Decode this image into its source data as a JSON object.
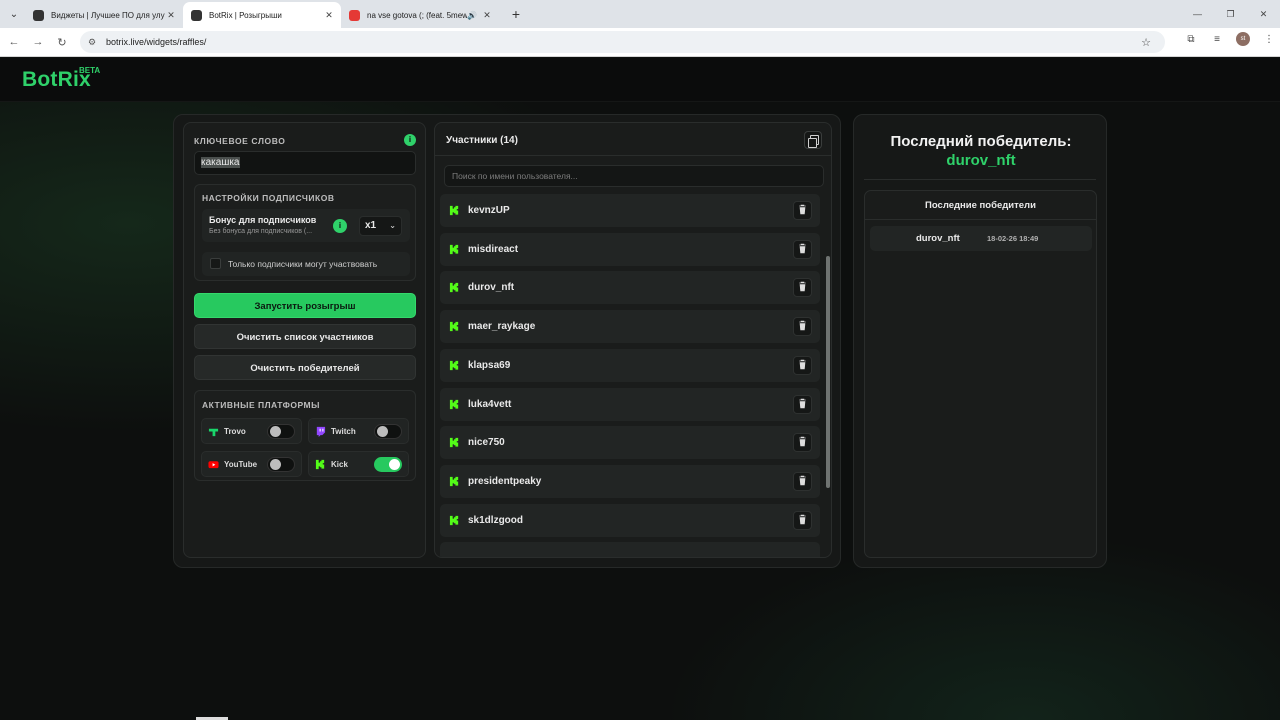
{
  "browser": {
    "tabs": [
      {
        "title": "Виджеты | Лучшее ПО для улу",
        "favicon_color": "#333333"
      },
      {
        "title": "BotRix | Розыгрыши",
        "favicon_color": "#333333"
      },
      {
        "title": "na vse gotova (; (feat. 5mewm",
        "favicon_color": "#e53935"
      }
    ],
    "url": "botrix.live/widgets/raffles/",
    "profile_initials": "st"
  },
  "brand": {
    "name": "BotRix",
    "badge": "BETA",
    "accent": "#2fd16a"
  },
  "keyword": {
    "label": "КЛЮЧЕВОЕ СЛОВО",
    "value": "какашка"
  },
  "subscribers": {
    "title": "НАСТРОЙКИ ПОДПИСЧИКОВ",
    "bonus_title": "Бонус для подписчиков",
    "bonus_sub": "Без бонуса для подписчиков (...",
    "multiplier": "x1",
    "only_subs_label": "Только подписчики могут участвовать",
    "only_subs_checked": false
  },
  "actions": {
    "start": "Запустить розыгрыш",
    "clear_participants": "Очистить список участников",
    "clear_winners": "Очистить победителей"
  },
  "platforms": {
    "title": "АКТИВНЫЕ ПЛАТФОРМЫ",
    "items": [
      {
        "name": "Trovo",
        "enabled": false,
        "icon": "trovo-icon",
        "color": "#19d66b"
      },
      {
        "name": "Twitch",
        "enabled": false,
        "icon": "twitch-icon",
        "color": "#9146ff"
      },
      {
        "name": "YouTube",
        "enabled": false,
        "icon": "youtube-icon",
        "color": "#ff0000"
      },
      {
        "name": "Kick",
        "enabled": true,
        "icon": "kick-icon",
        "color": "#53fc18"
      }
    ]
  },
  "participants": {
    "title": "Участники (14)",
    "search_placeholder": "Поиск по имени пользователя...",
    "items": [
      "kevnzUP",
      "misdireact",
      "durov_nft",
      "maer_raykage",
      "klapsa69",
      "luka4vett",
      "nice750",
      "presidentpeaky",
      "sk1dlzgood"
    ]
  },
  "winner": {
    "title": "Последний победитель:",
    "name": "durov_nft",
    "recent_title": "Последние победители",
    "recent": [
      {
        "name": "durov_nft",
        "date": "18-02-26 18:49"
      }
    ]
  }
}
